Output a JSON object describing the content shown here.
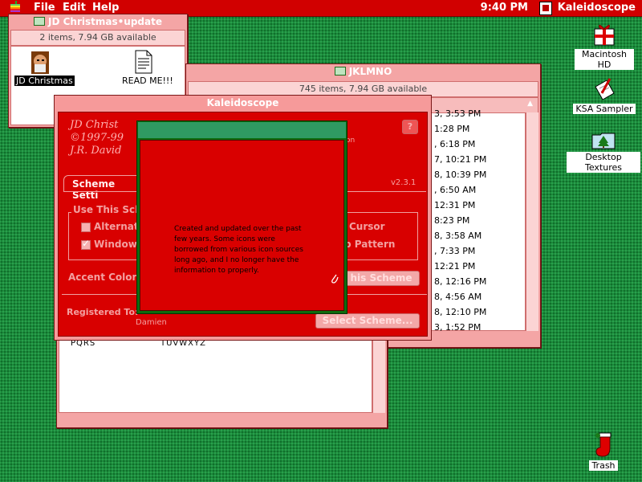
{
  "menubar": {
    "items": [
      "File",
      "Edit",
      "Help"
    ],
    "clock": "9:40 PM",
    "active_app": "Kaleidoscope"
  },
  "windows": {
    "jd": {
      "title": "JD Christmas•update",
      "info": "2 items, 7.94 GB available",
      "items": [
        {
          "label": "JD Christmas",
          "icon": "santa-icon"
        },
        {
          "label": "READ ME!!!",
          "icon": "document-icon"
        }
      ]
    },
    "jklmno": {
      "title": "JKLMNO",
      "info": "745 items, 7.94 GB available",
      "dates": [
        "3, 3:53 PM",
        "1:28 PM",
        ", 6:18 PM",
        "7, 10:21 PM",
        "8, 10:39 PM",
        ", 6:50 AM",
        "12:31 PM",
        "8:23 PM",
        "8, 3:58 AM",
        ", 7:33 PM",
        "12:21 PM",
        "8, 12:16 PM",
        "8, 4:56 AM",
        "8, 12:10 PM",
        "3, 1:52 PM"
      ]
    },
    "lower": {
      "labels": [
        "PQRS",
        "TUVWXYZ"
      ]
    }
  },
  "kaleidoscope": {
    "title": "Kaleidoscope",
    "credit_lines": [
      "JD Christ",
      "©1997-99",
      "J.R. David"
    ],
    "version": "v2.3.1",
    "tab": "Scheme Setti",
    "group_label": "Use This Sche",
    "options_left": [
      "Alternat",
      "Window"
    ],
    "options_right": [
      "Cursor",
      "p Pattern"
    ],
    "accent_label": "Accent Color:",
    "apply_button": "his Scheme",
    "registered_label": "Registered To:",
    "registered_name": "Damien",
    "select_button": "Select Scheme...",
    "hidden_right_text": "on"
  },
  "dialog": {
    "text": "Created and updated over the past few years. Some icons were borrowed from various icon sources long ago, and I no longer have the information to properly."
  },
  "desktop": {
    "icons": [
      {
        "label": "Macintosh HD",
        "icon": "gift-drive-icon"
      },
      {
        "label": "KSA Sampler",
        "icon": "pen-document-icon"
      },
      {
        "label": "Desktop Textures",
        "icon": "tree-folder-icon"
      },
      {
        "label": "Trash",
        "icon": "stocking-trash-icon"
      }
    ]
  },
  "colors": {
    "menubar": "#d10000",
    "desktop": "#1c8a3c",
    "window": "#f4a5a5",
    "panel": "#d80000",
    "dialog_title": "#2f9a62"
  }
}
